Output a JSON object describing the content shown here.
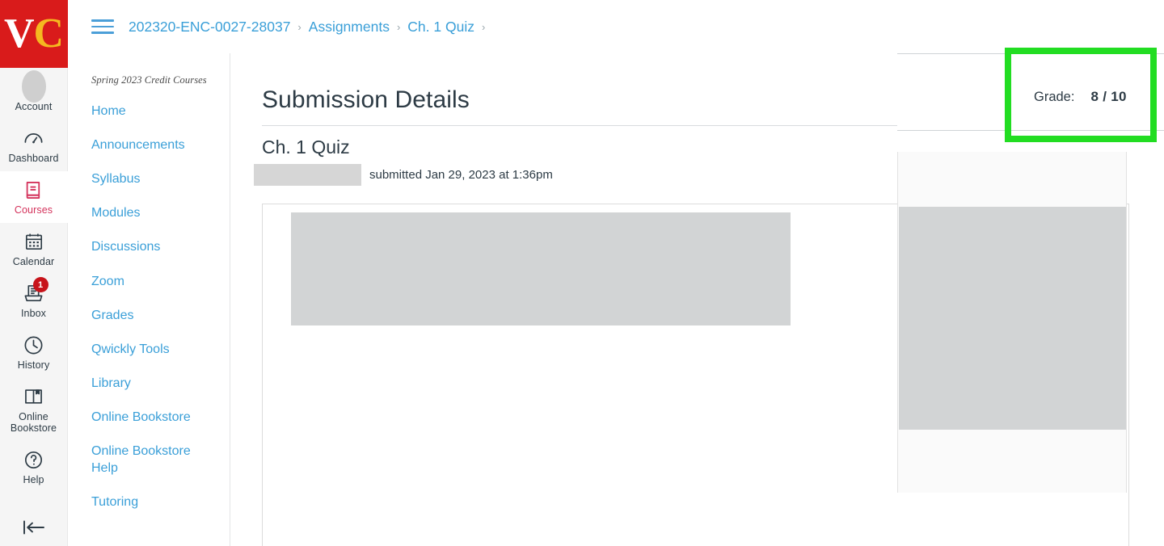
{
  "global_nav": {
    "brand": {
      "text_v": "V",
      "text_c": "C",
      "bg_color": "#d91b1b"
    },
    "collapse_icon": "collapse-left-arrow-icon",
    "items": [
      {
        "label": "Account",
        "icon": "user-avatar-icon",
        "active": false,
        "badge": null
      },
      {
        "label": "Dashboard",
        "icon": "dashboard-gauge-icon",
        "active": false,
        "badge": null
      },
      {
        "label": "Courses",
        "icon": "courses-book-icon",
        "active": true,
        "badge": null
      },
      {
        "label": "Calendar",
        "icon": "calendar-icon",
        "active": false,
        "badge": null
      },
      {
        "label": "Inbox",
        "icon": "inbox-tray-icon",
        "active": false,
        "badge": "1"
      },
      {
        "label": "History",
        "icon": "clock-history-icon",
        "active": false,
        "badge": null
      },
      {
        "label": "Online Bookstore",
        "icon": "open-book-icon",
        "active": false,
        "badge": null
      },
      {
        "label": "Help",
        "icon": "question-circle-icon",
        "active": false,
        "badge": null
      }
    ]
  },
  "topbar": {
    "menu_icon": "hamburger-menu-icon",
    "breadcrumb": [
      {
        "label": "202320-ENC-0027-28037"
      },
      {
        "label": "Assignments"
      },
      {
        "label": "Ch. 1 Quiz"
      }
    ],
    "separator": "›"
  },
  "course_nav": {
    "term": "Spring 2023 Credit Courses",
    "items": [
      {
        "label": "Home"
      },
      {
        "label": "Announcements"
      },
      {
        "label": "Syllabus"
      },
      {
        "label": "Modules"
      },
      {
        "label": "Discussions"
      },
      {
        "label": "Zoom"
      },
      {
        "label": "Grades"
      },
      {
        "label": "Qwickly Tools"
      },
      {
        "label": "Library"
      },
      {
        "label": "Online Bookstore"
      },
      {
        "label": "Online Bookstore Help"
      },
      {
        "label": "Tutoring"
      }
    ]
  },
  "main": {
    "page_title": "Submission Details",
    "assignment_title": "Ch. 1 Quiz",
    "submitter_name_redacted": "",
    "submitted_text": "submitted Jan 29, 2023 at 1:36pm"
  },
  "grade": {
    "label": "Grade:",
    "value": "8 / 10",
    "score": 8,
    "points_possible": 10,
    "highlight_color": "#22dd22"
  }
}
